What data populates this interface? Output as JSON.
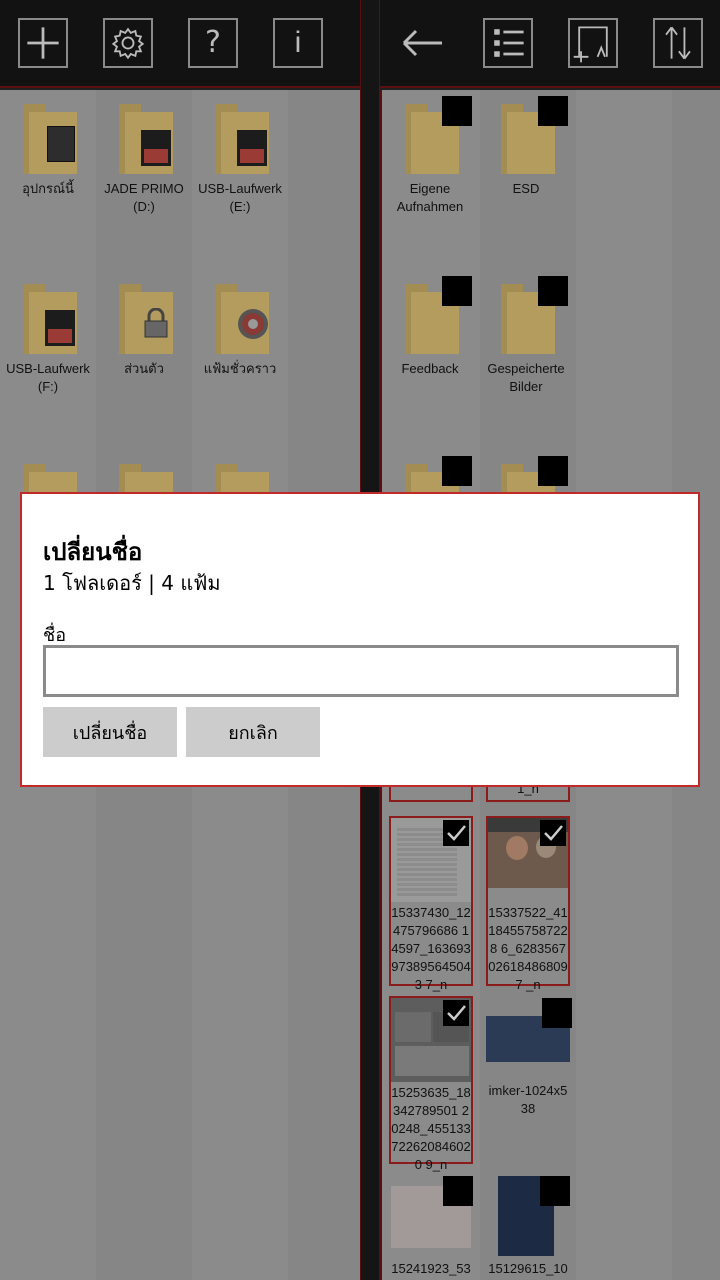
{
  "toolbar_left": {
    "icons": [
      "add-icon",
      "settings-gear-icon",
      "help-question-icon",
      "info-icon"
    ],
    "help_glyph": "?",
    "info_glyph": "i"
  },
  "toolbar_right": {
    "icons": [
      "back-arrow-icon",
      "list-view-icon",
      "select-area-icon",
      "sort-icon"
    ]
  },
  "left_pane": {
    "items": [
      {
        "label": "อุปกรณ์นี้",
        "icon": "phone-device-icon"
      },
      {
        "label": "JADE PRIMO (D:)",
        "icon": "sd-card-icon"
      },
      {
        "label": "USB-Laufwerk (E:)",
        "icon": "sd-card-icon"
      },
      {
        "label": "USB-Laufwerk (F:)",
        "icon": "sd-card-icon"
      },
      {
        "label": "ส่วนตัว",
        "icon": "lock-icon"
      },
      {
        "label": "แฟ้มชั่วคราว",
        "icon": "gear-icon"
      }
    ]
  },
  "right_pane": {
    "folders": [
      {
        "label": "Eigene Aufnahmen"
      },
      {
        "label": "ESD"
      },
      {
        "label": "Feedback"
      },
      {
        "label": "Gespeicherte Bilder"
      }
    ],
    "files": [
      {
        "label": "15337430_12475796686 14597_163693973895645043 7_n",
        "checked": true
      },
      {
        "label": "15337522_41184557587228 6_6283567026184868097 _n",
        "checked": true
      },
      {
        "label": "15253635_18342789501 20248_455133722620846020 9_n",
        "checked": true
      },
      {
        "label": "imker-1024x538",
        "checked": false
      },
      {
        "label": "15241923_53",
        "checked": false
      },
      {
        "label": "15129615_10",
        "checked": false
      }
    ],
    "partial_labels": [
      "1_n"
    ]
  },
  "dialog": {
    "title": "เปลี่ยนชื่อ",
    "subtitle": "1 โฟลเดอร์ | 4 แฟ้ม",
    "name_label": "ชื่อ",
    "name_value": "",
    "rename_button": "เปลี่ยนชื่อ",
    "cancel_button": "ยกเลิก"
  },
  "colors": {
    "accent": "#c02a2a",
    "toolbar_bg": "#121212",
    "overlay_bg": "#8b8b8b",
    "dialog_bg": "#ffffff",
    "button_bg": "#cccccc"
  }
}
